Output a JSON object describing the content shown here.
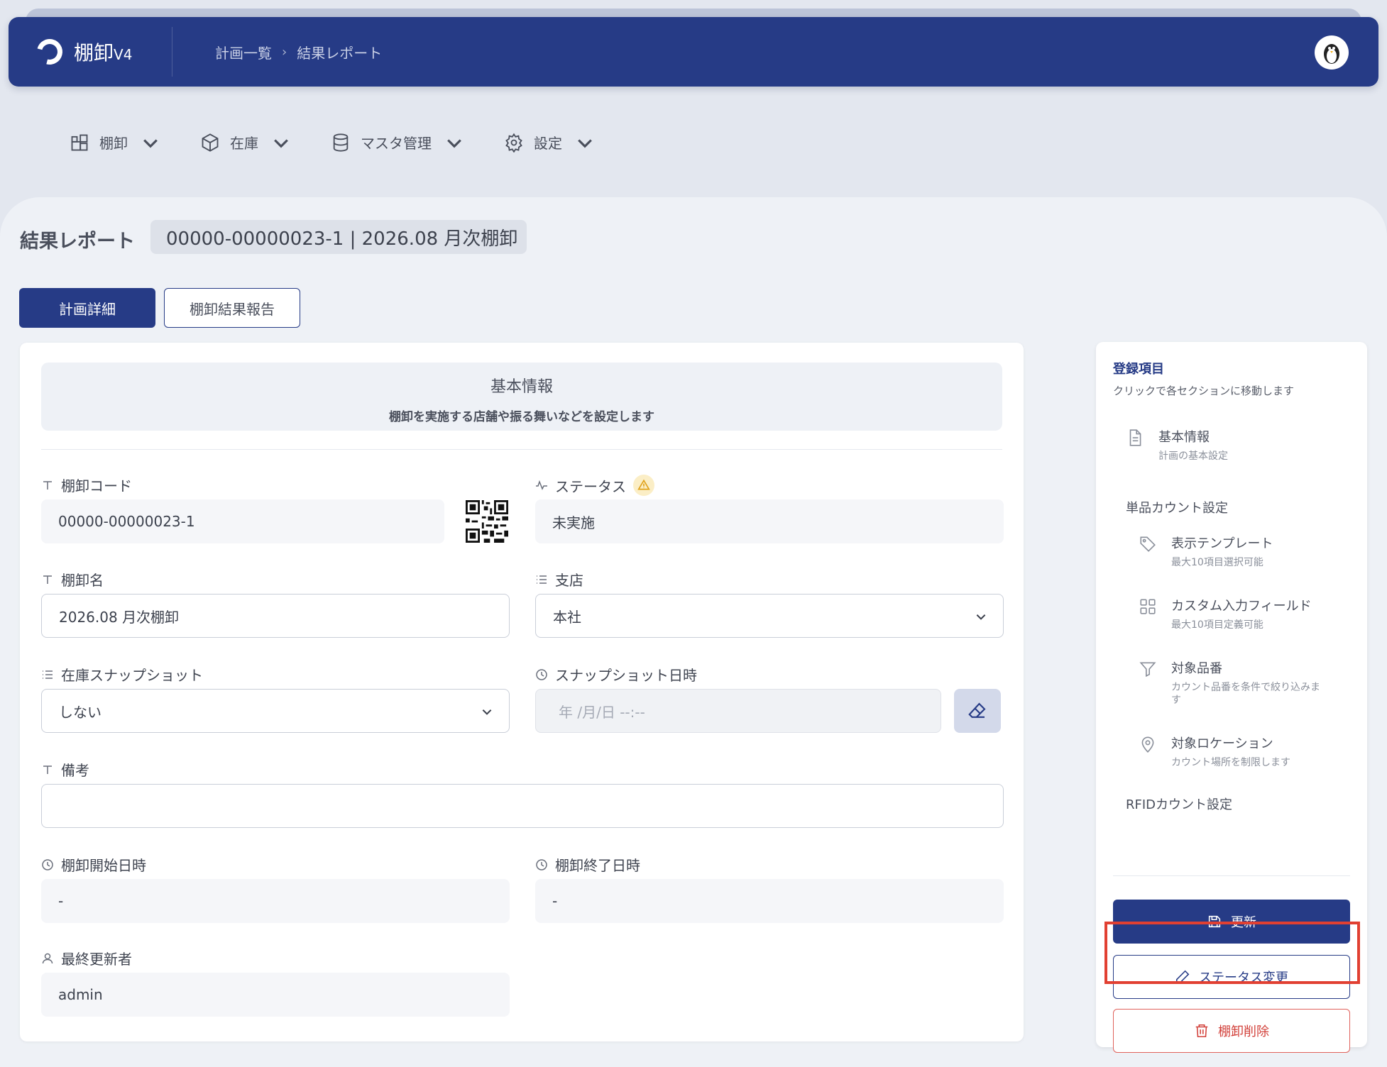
{
  "header": {
    "app_name": "棚卸",
    "app_version": "V4",
    "breadcrumb": [
      "計画一覧",
      "結果レポート"
    ],
    "avatar_icon": "penguin-avatar"
  },
  "nav": [
    {
      "label": "棚卸",
      "icon": "blocks-icon"
    },
    {
      "label": "在庫",
      "icon": "box-icon"
    },
    {
      "label": "マスタ管理",
      "icon": "database-icon"
    },
    {
      "label": "設定",
      "icon": "gear-icon"
    }
  ],
  "page": {
    "title": "結果レポート",
    "code": "00000-00000023-1 | 2026.08 月次棚卸"
  },
  "tabs": [
    {
      "label": "計画詳細",
      "active": true
    },
    {
      "label": "棚卸結果報告",
      "active": false
    }
  ],
  "basic": {
    "title": "基本情報",
    "subtitle": "棚卸を実施する店舗や振る舞いなどを設定します"
  },
  "fields": {
    "code": {
      "label": "棚卸コード",
      "value": "00000-00000023-1"
    },
    "status": {
      "label": "ステータス",
      "value": "未実施"
    },
    "name": {
      "label": "棚卸名",
      "value": "2026.08 月次棚卸"
    },
    "branch": {
      "label": "支店",
      "value": "本社"
    },
    "snapshot": {
      "label": "在庫スナップショット",
      "value": "しない"
    },
    "snapshot_datetime": {
      "label": "スナップショット日時",
      "placeholder": "年 /月/日 --:--"
    },
    "note": {
      "label": "備考",
      "value": ""
    },
    "start": {
      "label": "棚卸開始日時",
      "value": "-"
    },
    "end": {
      "label": "棚卸終了日時",
      "value": "-"
    },
    "updated_by": {
      "label": "最終更新者",
      "value": "admin"
    }
  },
  "sidebar": {
    "title": "登録項目",
    "subtitle": "クリックで各セクションに移動します",
    "items": [
      {
        "title": "基本情報",
        "sub": "計画の基本設定",
        "icon": "document-icon"
      },
      {
        "group": "単品カウント設定"
      },
      {
        "title": "表示テンプレート",
        "sub": "最大10項目選択可能",
        "icon": "tag-icon"
      },
      {
        "title": "カスタム入力フィールド",
        "sub": "最大10項目定義可能",
        "icon": "grid-icon"
      },
      {
        "title": "対象品番",
        "sub": "カウント品番を条件で絞り込みます",
        "icon": "filter-icon"
      },
      {
        "title": "対象ロケーション",
        "sub": "カウント場所を制限します",
        "icon": "location-pin-icon"
      },
      {
        "group": "RFIDカウント設定"
      }
    ],
    "buttons": {
      "update": "更新",
      "status_change": "ステータス変更",
      "delete": "棚卸削除"
    }
  },
  "colors": {
    "primary": "#263b86",
    "danger": "#d2403a",
    "highlight": "#e14032"
  }
}
